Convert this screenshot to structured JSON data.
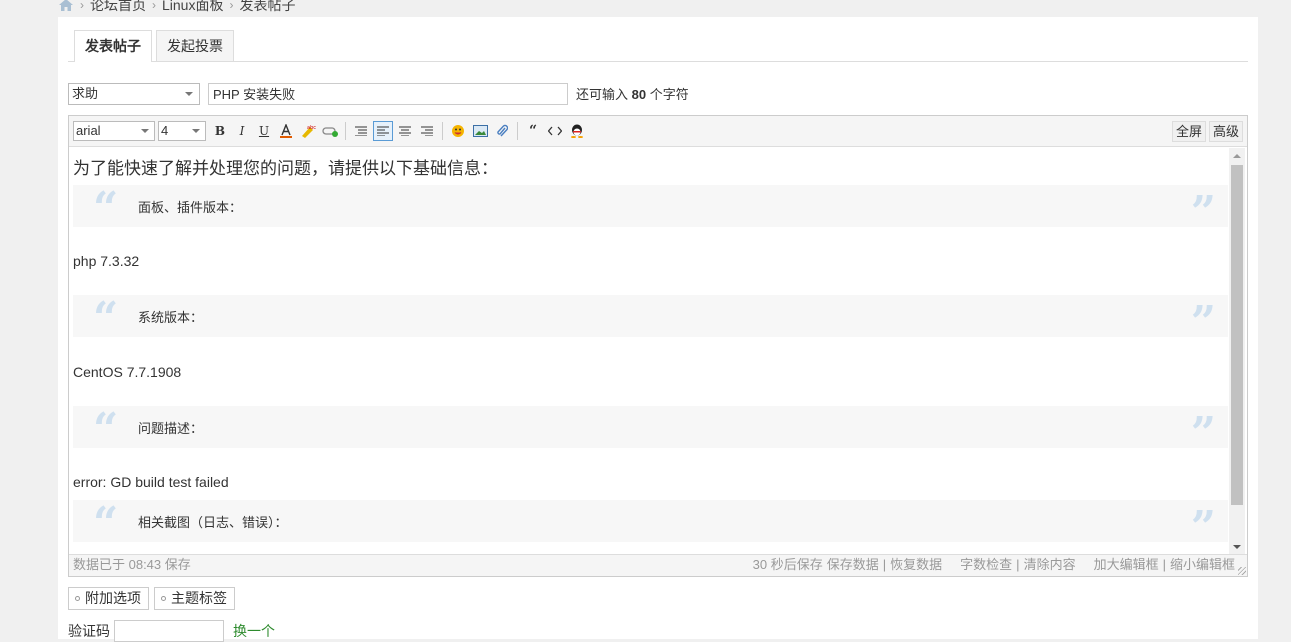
{
  "breadcrumb": {
    "home_icon": "home-icon",
    "items": [
      "论坛首页",
      "Linux面板",
      "发表帖子"
    ],
    "separator": "›"
  },
  "tabs": [
    {
      "label": "发表帖子",
      "active": true
    },
    {
      "label": "发起投票",
      "active": false
    }
  ],
  "post": {
    "type_selected": "求助",
    "subject_value": "PHP 安装失败",
    "char_prefix": "还可输入",
    "char_count": "80",
    "char_suffix": "个字符"
  },
  "toolbar": {
    "font": "arial",
    "size": "4",
    "fullscreen": "全屏",
    "advanced": "高级",
    "active_button": "align-left-icon"
  },
  "content": {
    "intro": "为了能快速了解并处理您的问题，请提供以下基础信息：",
    "blocks": [
      {
        "quote": "面板、插件版本：",
        "value": "php 7.3.32"
      },
      {
        "quote": "系统版本：",
        "value": "CentOS 7.7.1908"
      },
      {
        "quote": "问题描述：",
        "value": "error: GD build test failed"
      },
      {
        "quote": "相关截图（日志、错误）：",
        "value": ""
      }
    ]
  },
  "statusbar": {
    "saved": "数据已于 08:43 保存",
    "autosave": "30 秒后保存",
    "save": "保存数据",
    "restore": "恢复数据",
    "check": "字数检查",
    "clear": "清除内容",
    "enlarge": "加大编辑框",
    "shrink": "缩小编辑框",
    "divider": "|"
  },
  "extras": {
    "options": "附加选项",
    "tags": "主题标签"
  },
  "captcha": {
    "label": "验证码",
    "value": "",
    "refresh": "换一个"
  },
  "colors": {
    "accent": "#5a9bd5",
    "quote_mark": "#cfe0ef",
    "refresh_link": "#2e8b2e"
  }
}
